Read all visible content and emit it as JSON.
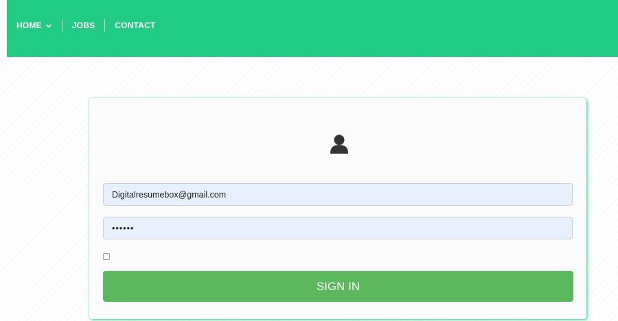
{
  "nav": {
    "home_label": "HOME",
    "jobs_label": "JOBS",
    "contact_label": "CONTACT",
    "home_dropdown_icon": "chevron-down-icon"
  },
  "login": {
    "avatar_icon": "user-icon",
    "email_value": "Digitalresumebox@gmail.com",
    "password_value": "••••••",
    "remember_checked": false,
    "signin_label": "SIGN IN"
  },
  "colors": {
    "header_green": "#21cb83",
    "button_green": "#5cb85c",
    "input_autofill_bg": "#e8f0fe",
    "avatar": "#333333"
  }
}
